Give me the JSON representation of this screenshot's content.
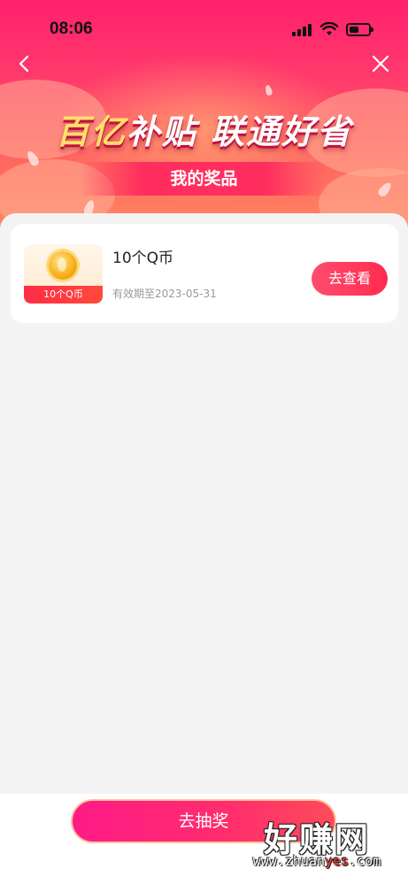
{
  "status_bar": {
    "time": "08:06"
  },
  "nav": {
    "back_icon": "chevron-left-icon",
    "close_icon": "close-icon"
  },
  "banner": {
    "title_part1": "百亿",
    "title_part2": "补贴 联通好省",
    "subtitle": "我的奖品"
  },
  "prizes": [
    {
      "thumb_label": "10个Q币",
      "name": "10个Q币",
      "expiry": "有效期至2023-05-31",
      "button_label": "去查看"
    }
  ],
  "bottom": {
    "draw_button_label": "去抽奖"
  },
  "watermark": {
    "main": "好赚网",
    "url_pre": "www.zhuan",
    "url_hl": "yes",
    "url_post": ".com"
  },
  "colors": {
    "header_top": "#ff1f6e",
    "header_bottom": "#ff8a63",
    "accent": "#ff2b4f",
    "title_gold": "#ffe06a"
  }
}
